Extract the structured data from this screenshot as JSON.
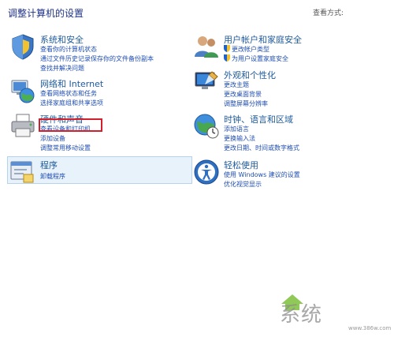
{
  "header": {
    "title": "调整计算机的设置",
    "view_by": "查看方式:"
  },
  "categories": [
    {
      "id": "system",
      "title": "系统和安全",
      "links": [
        "查看你的计算机状态",
        "通过文件历史记录保存你的文件备份副本",
        "查找并解决问题"
      ]
    },
    {
      "id": "network",
      "title": "网络和 Internet",
      "links": [
        "查看网络状态和任务",
        "选择家庭组和共享选项"
      ]
    },
    {
      "id": "hardware",
      "title": "硬件和声音",
      "links": [
        "查看设备和打印机",
        "添加设备",
        "调整常用移动设置"
      ]
    },
    {
      "id": "programs",
      "title": "程序",
      "links": [
        "卸载程序"
      ]
    },
    {
      "id": "accounts",
      "title": "用户帐户和家庭安全",
      "links": [
        "更改帐户类型",
        "为用户设置家庭安全"
      ]
    },
    {
      "id": "appearance",
      "title": "外观和个性化",
      "links": [
        "更改主题",
        "更改桌面背景",
        "调整屏幕分辨率"
      ]
    },
    {
      "id": "clock",
      "title": "时钟、语言和区域",
      "links": [
        "添加语言",
        "更换输入法",
        "更改日期、时间或数字格式"
      ]
    },
    {
      "id": "ease",
      "title": "轻松使用",
      "links": [
        "使用 Windows 建议的设置",
        "优化视觉显示"
      ]
    }
  ],
  "watermark": {
    "logo": "系统",
    "url": "www.386w.com"
  },
  "colors": {
    "title": "#1e3287",
    "category_title": "#1e5a9b",
    "link": "#1f4db0",
    "highlight": "#e8f2fb",
    "annotation": "#d11f2b"
  }
}
